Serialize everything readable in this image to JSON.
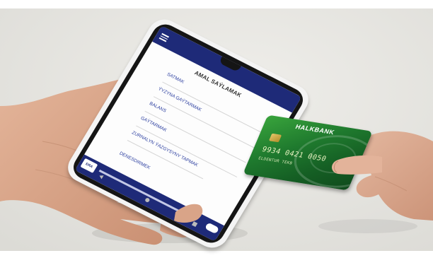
{
  "app": {
    "title": "AMAL SAÝLAMAK",
    "menu_items": [
      "SATMAK",
      "ÝYZYNA GAÝTARMAK",
      "BALANS",
      "GAÝTARMAK",
      "ZURNALYN ÝAZGYSYNY TAPMAK",
      "DENESDIRMEK"
    ]
  },
  "card": {
    "bank_name": "HALKBANK",
    "number": "9934 0421 0050",
    "holder": "ELDENTUR TEKB"
  },
  "colors": {
    "app_header": "#1e2a78",
    "menu_text": "#2c3fa0",
    "card_green": "#1f7a2e"
  }
}
